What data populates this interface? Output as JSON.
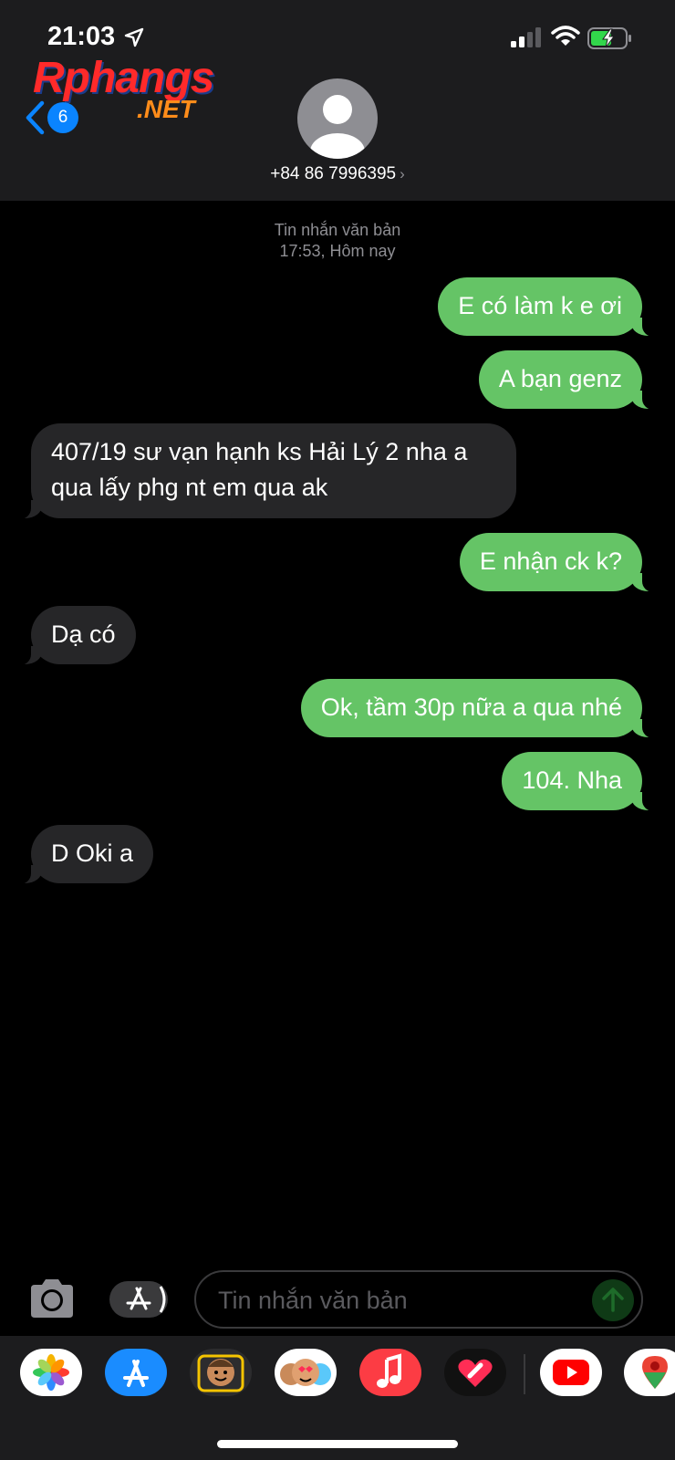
{
  "status_bar": {
    "time": "21:03"
  },
  "watermark": {
    "main": "Rphangs",
    "sub": ".NET"
  },
  "header": {
    "back_badge": "6",
    "contact": "+84 86 7996395",
    "chevron": "›"
  },
  "conversation": {
    "meta_type": "Tin nhắn văn bản",
    "meta_time": "17:53, Hôm nay",
    "messages": [
      {
        "from": "me",
        "text": "E có làm k e ơi"
      },
      {
        "from": "me",
        "text": "A bạn genz"
      },
      {
        "from": "them",
        "text": "407/19 sư vạn hạnh ks Hải Lý 2 nha a qua lấy phg nt em qua ak"
      },
      {
        "from": "me",
        "text": "E nhận ck k?"
      },
      {
        "from": "them",
        "text": "Dạ có"
      },
      {
        "from": "me",
        "text": "Ok, tầm 30p nữa a qua nhé"
      },
      {
        "from": "me",
        "text": "104. Nha"
      },
      {
        "from": "them",
        "text": "D Oki a"
      }
    ]
  },
  "compose": {
    "placeholder": "Tin nhắn văn bản"
  },
  "app_drawer": [
    {
      "icon": "photos-icon"
    },
    {
      "icon": "app-store-icon"
    },
    {
      "icon": "memoji-stickers-icon"
    },
    {
      "icon": "animoji-icon"
    },
    {
      "icon": "music-icon"
    },
    {
      "icon": "digital-touch-icon"
    },
    {
      "icon": "youtube-icon"
    },
    {
      "icon": "google-maps-icon"
    }
  ],
  "colors": {
    "sent_bubble": "#65c466",
    "received_bubble": "#262628",
    "accent": "#0a84ff",
    "header_bg": "#1c1c1e"
  }
}
